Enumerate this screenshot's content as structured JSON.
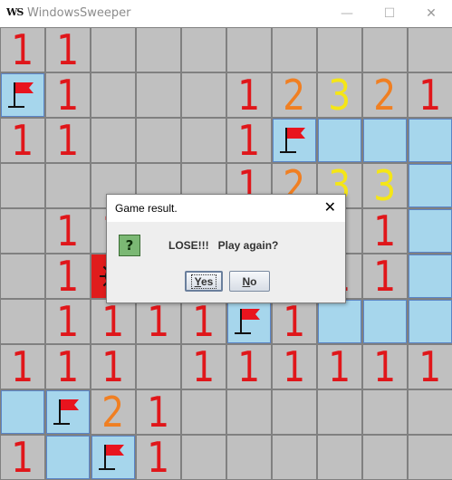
{
  "window": {
    "title": "WindowsSweeper",
    "icon_text": "WS",
    "minimize_glyph": "—",
    "maximize_glyph": "☐",
    "close_glyph": "✕"
  },
  "colors": {
    "unopened": "#c0c0c0",
    "opened": "#a6d6ec",
    "gridline": "#808080",
    "num_1": "#e0161a",
    "num_2": "#f07f22",
    "num_3": "#f5e616",
    "flag": "#e8141e",
    "mine_bg": "#e01c1c"
  },
  "board": {
    "columns": 10,
    "rows": 10,
    "legend": "n = number, F = flag, O = opened blank, U = unopened, M = exploded mine",
    "grid": [
      [
        "1",
        "1",
        "U",
        "U",
        "U",
        "U",
        "U",
        "U",
        "U",
        "U"
      ],
      [
        "F",
        "1",
        "U",
        "U",
        "U",
        "1",
        "2",
        "3",
        "2",
        "1"
      ],
      [
        "1",
        "1",
        "U",
        "U",
        "U",
        "1",
        "F",
        "O",
        "O",
        "O"
      ],
      [
        "U",
        "U",
        "U",
        "U",
        "U",
        "1",
        "2",
        "3",
        "3",
        "O"
      ],
      [
        "U",
        "1",
        "1",
        "U",
        "U",
        "U",
        "U",
        "U",
        "1",
        "O"
      ],
      [
        "U",
        "1",
        "M",
        "U",
        "U",
        "U",
        "U",
        "1",
        "1",
        "O"
      ],
      [
        "U",
        "1",
        "1",
        "1",
        "1",
        "F",
        "1",
        "O",
        "O",
        "O"
      ],
      [
        "1",
        "1",
        "1",
        "U",
        "1",
        "1",
        "1",
        "1",
        "1",
        "1"
      ],
      [
        "O",
        "F",
        "2",
        "1",
        "U",
        "U",
        "U",
        "U",
        "U",
        "U"
      ],
      [
        "1",
        "O",
        "F",
        "1",
        "U",
        "U",
        "U",
        "U",
        "U",
        "U"
      ]
    ]
  },
  "dialog": {
    "title": "Game result.",
    "close_glyph": "✕",
    "icon_glyph": "?",
    "icon_name": "question-icon",
    "message": "LOSE!!!   Play again?",
    "yes_label_first": "Y",
    "yes_label_rest": "es",
    "no_label_first": "N",
    "no_label_rest": "o"
  }
}
